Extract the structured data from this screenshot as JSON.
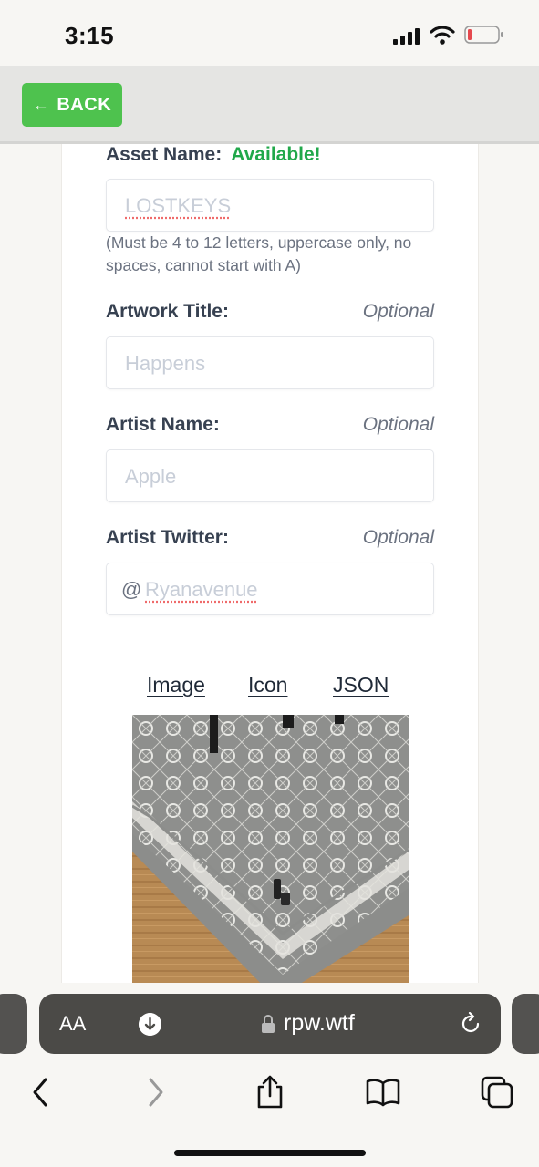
{
  "status_bar": {
    "time": "3:15"
  },
  "header": {
    "back_label": "BACK"
  },
  "form": {
    "asset_name": {
      "label": "Asset Name:",
      "status": "Available!",
      "value": "LOSTKEYS",
      "hint": "(Must be 4 to 12 letters, uppercase only, no spaces, cannot start with A)"
    },
    "artwork_title": {
      "label": "Artwork Title:",
      "optional": "Optional",
      "placeholder": "Happens"
    },
    "artist_name": {
      "label": "Artist Name:",
      "optional": "Optional",
      "placeholder": "Apple"
    },
    "artist_twitter": {
      "label": "Artist Twitter:",
      "optional": "Optional",
      "prefix": "@",
      "placeholder": "Ryanavenue"
    }
  },
  "preview_tabs": [
    "Image",
    "Icon",
    "JSON"
  ],
  "browser": {
    "aa": "AA",
    "host": "rpw.wtf"
  },
  "icons": {
    "back": "arrow-left-icon",
    "download": "download-icon",
    "lock": "lock-icon",
    "reload": "reload-icon",
    "nav_back": "chevron-left-icon",
    "nav_forward": "chevron-right-icon",
    "share": "share-icon",
    "bookmarks": "book-icon",
    "tabs": "tabs-icon"
  },
  "colors": {
    "accent_green": "#4ec24e",
    "available_green": "#20a84a",
    "battery_low": "#e5484d"
  }
}
